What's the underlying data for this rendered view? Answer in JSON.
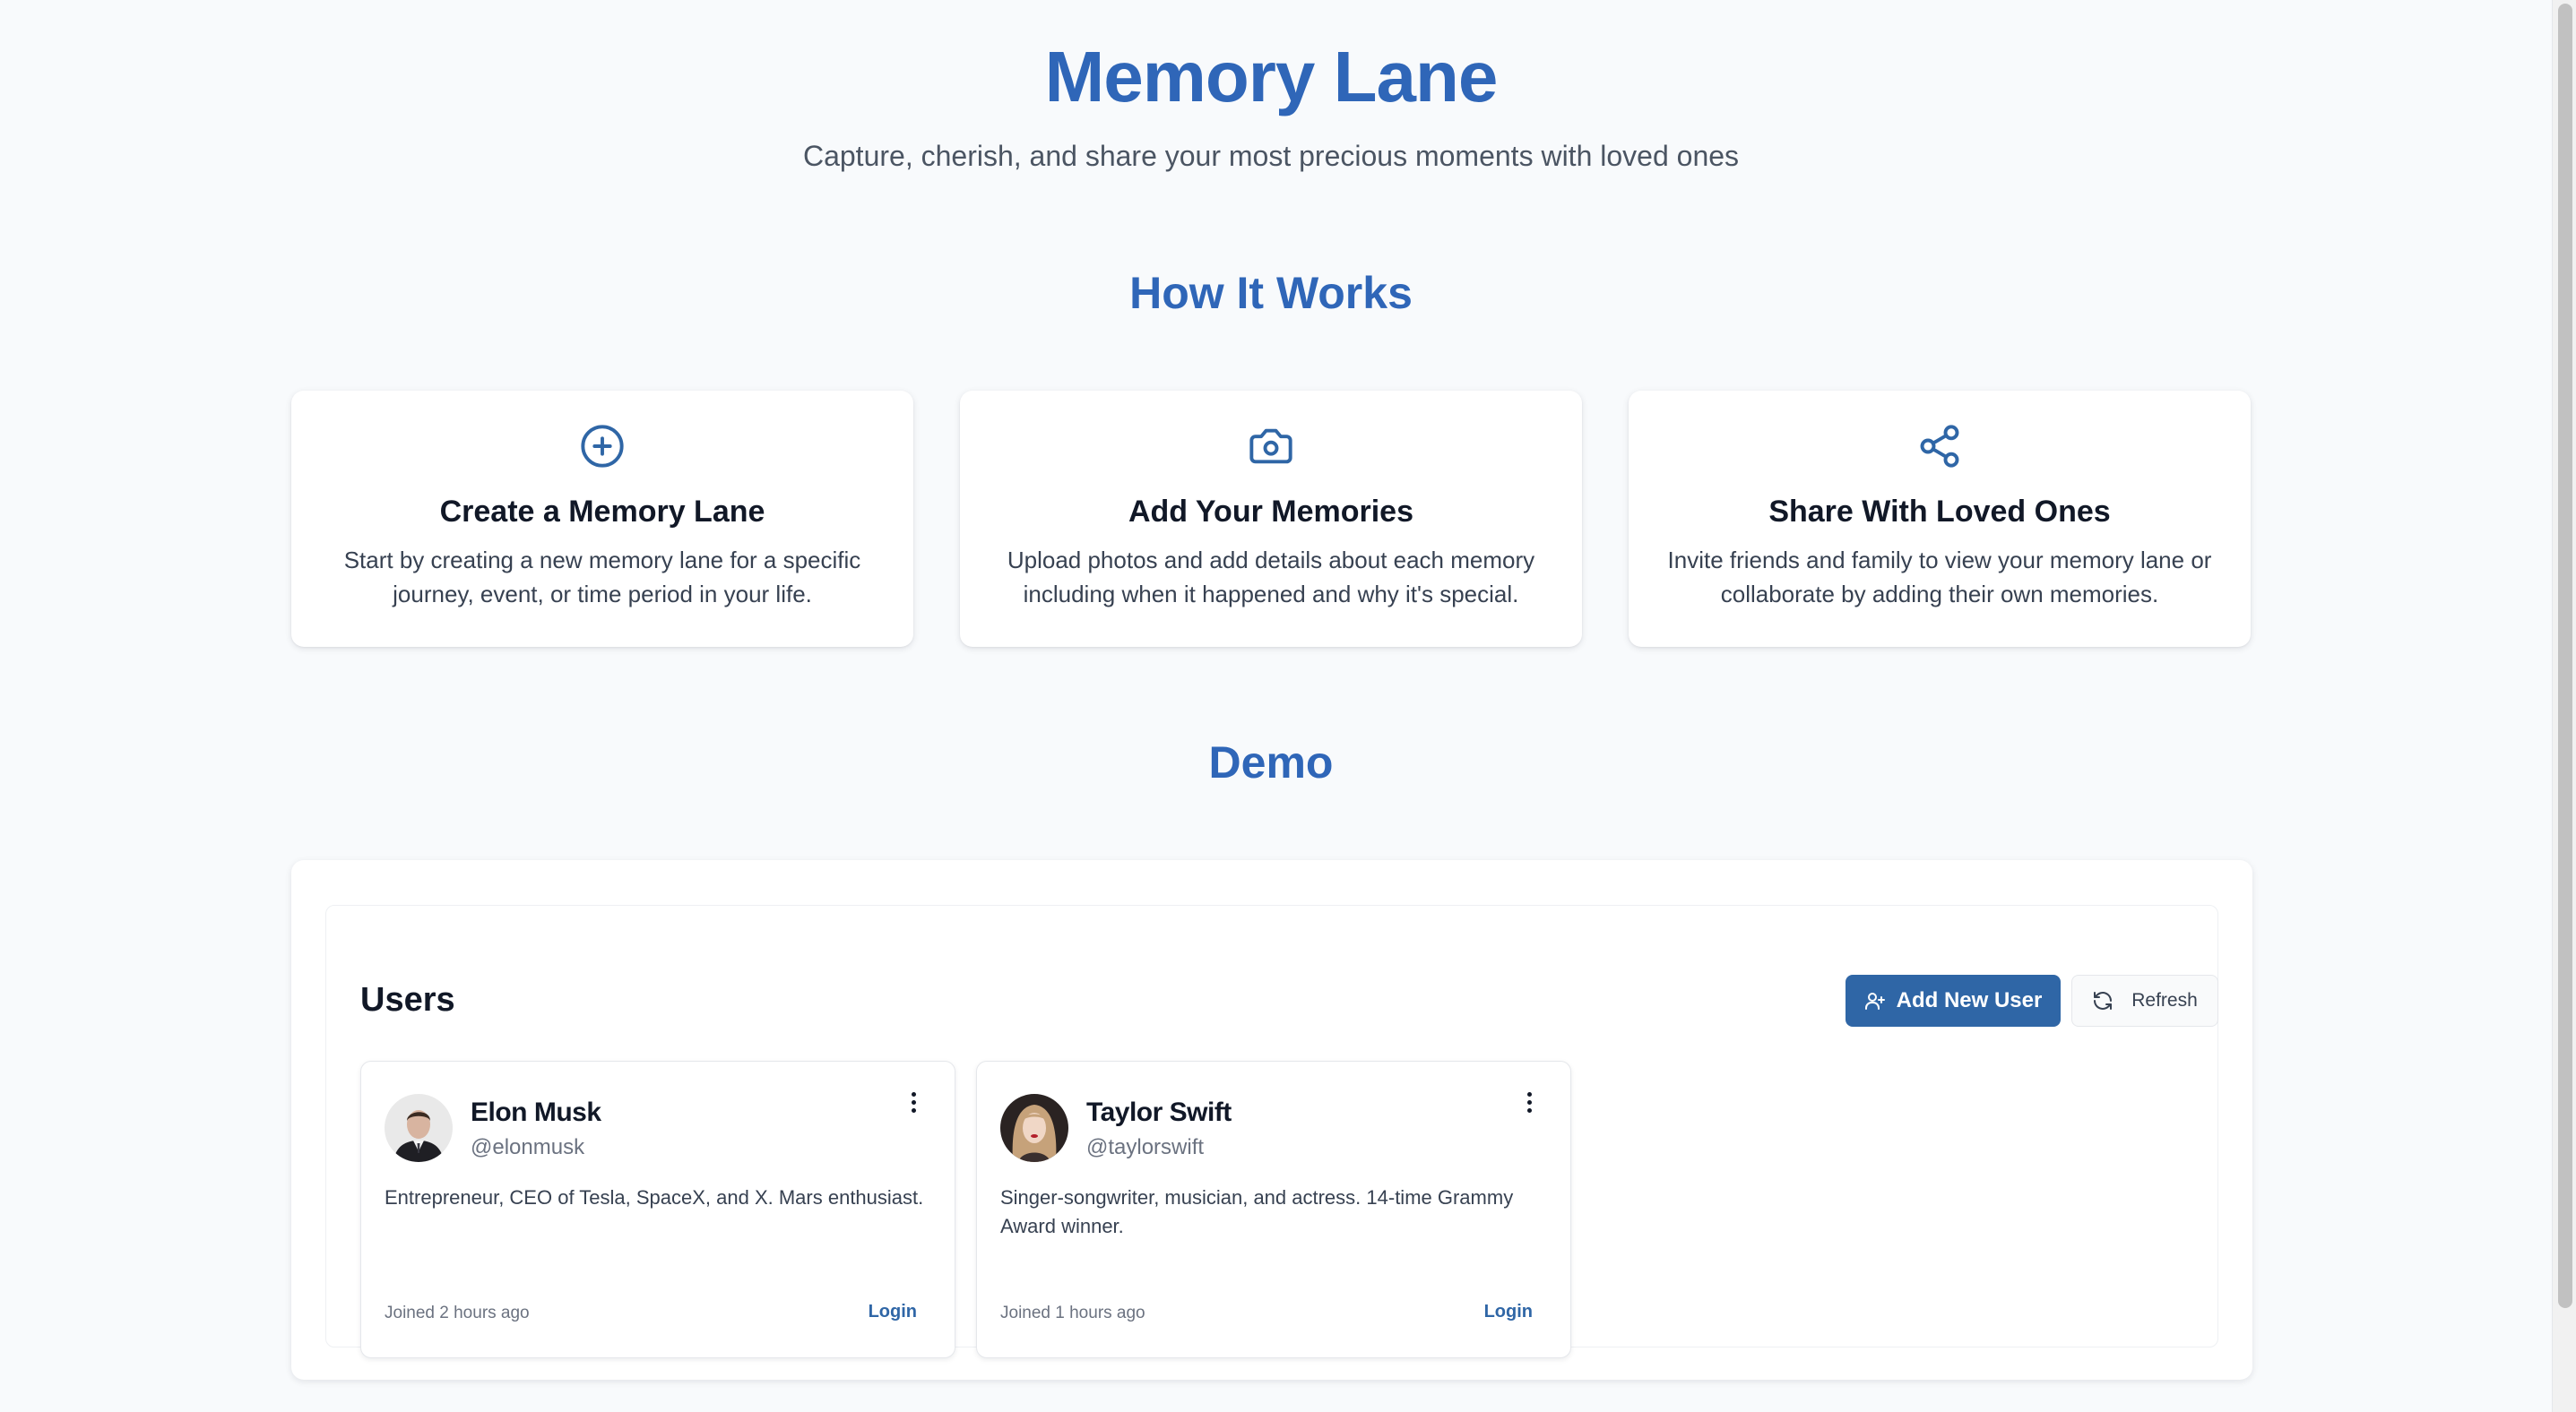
{
  "hero": {
    "title": "Memory Lane",
    "subtitle": "Capture, cherish, and share your most precious moments with loved ones"
  },
  "how_it_works": {
    "title": "How It Works",
    "features": [
      {
        "icon": "plus-circle-icon",
        "title": "Create a Memory Lane",
        "description": "Start by creating a new memory lane for a specific journey, event, or time period in your life."
      },
      {
        "icon": "camera-icon",
        "title": "Add Your Memories",
        "description": "Upload photos and add details about each memory including when it happened and why it's special."
      },
      {
        "icon": "share-icon",
        "title": "Share With Loved Ones",
        "description": "Invite friends and family to view your memory lane or collaborate by adding their own memories."
      }
    ]
  },
  "demo": {
    "title": "Demo",
    "users_title": "Users",
    "add_user_label": "Add New User",
    "refresh_label": "Refresh",
    "users": [
      {
        "name": "Elon Musk",
        "handle": "@elonmusk",
        "bio": "Entrepreneur, CEO of Tesla, SpaceX, and X. Mars enthusiast.",
        "joined": "Joined 2 hours ago",
        "login_label": "Login"
      },
      {
        "name": "Taylor Swift",
        "handle": "@taylorswift",
        "bio": "Singer-songwriter, musician, and actress. 14-time Grammy Award winner.",
        "joined": "Joined 1 hours ago",
        "login_label": "Login"
      }
    ]
  },
  "colors": {
    "accent": "#2f66b8",
    "button": "#2f66a6",
    "background": "#f8fafc"
  }
}
